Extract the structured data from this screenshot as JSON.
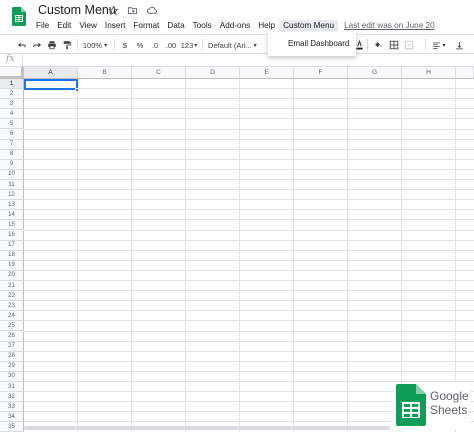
{
  "document": {
    "title": "Custom Menu",
    "last_edit": "Last edit was on June 20"
  },
  "menubar": {
    "items": [
      "File",
      "Edit",
      "View",
      "Insert",
      "Format",
      "Data",
      "Tools",
      "Add-ons",
      "Help",
      "Custom Menu"
    ],
    "active_item": "Custom Menu"
  },
  "toolbar": {
    "zoom": "100%",
    "currency": "$",
    "percent": "%",
    "decrease_decimal": ".0",
    "increase_decimal": ".00",
    "more_formats": "123",
    "font": "Default (Ari..."
  },
  "dropdown": {
    "items": [
      "Email Dashboard"
    ]
  },
  "formula_bar": {
    "fx_label": "fx",
    "value": ""
  },
  "grid": {
    "columns": [
      "A",
      "B",
      "C",
      "D",
      "E",
      "F",
      "G",
      "H"
    ],
    "rows": [
      "1",
      "2",
      "3",
      "4",
      "5",
      "6",
      "7",
      "8",
      "9",
      "10",
      "11",
      "12",
      "13",
      "14",
      "15",
      "16",
      "17",
      "18",
      "19",
      "20",
      "21",
      "22",
      "23",
      "24",
      "25",
      "26",
      "27",
      "28",
      "29",
      "30",
      "31",
      "32",
      "33",
      "34",
      "35"
    ],
    "active_cell": "A1"
  },
  "badge": {
    "line1": "Google",
    "line2": "Sheets",
    "brand_color": "#0f9d58"
  },
  "icons": {
    "star": "star-icon",
    "folder": "move-to-folder-icon",
    "cloud": "cloud-saved-icon"
  }
}
